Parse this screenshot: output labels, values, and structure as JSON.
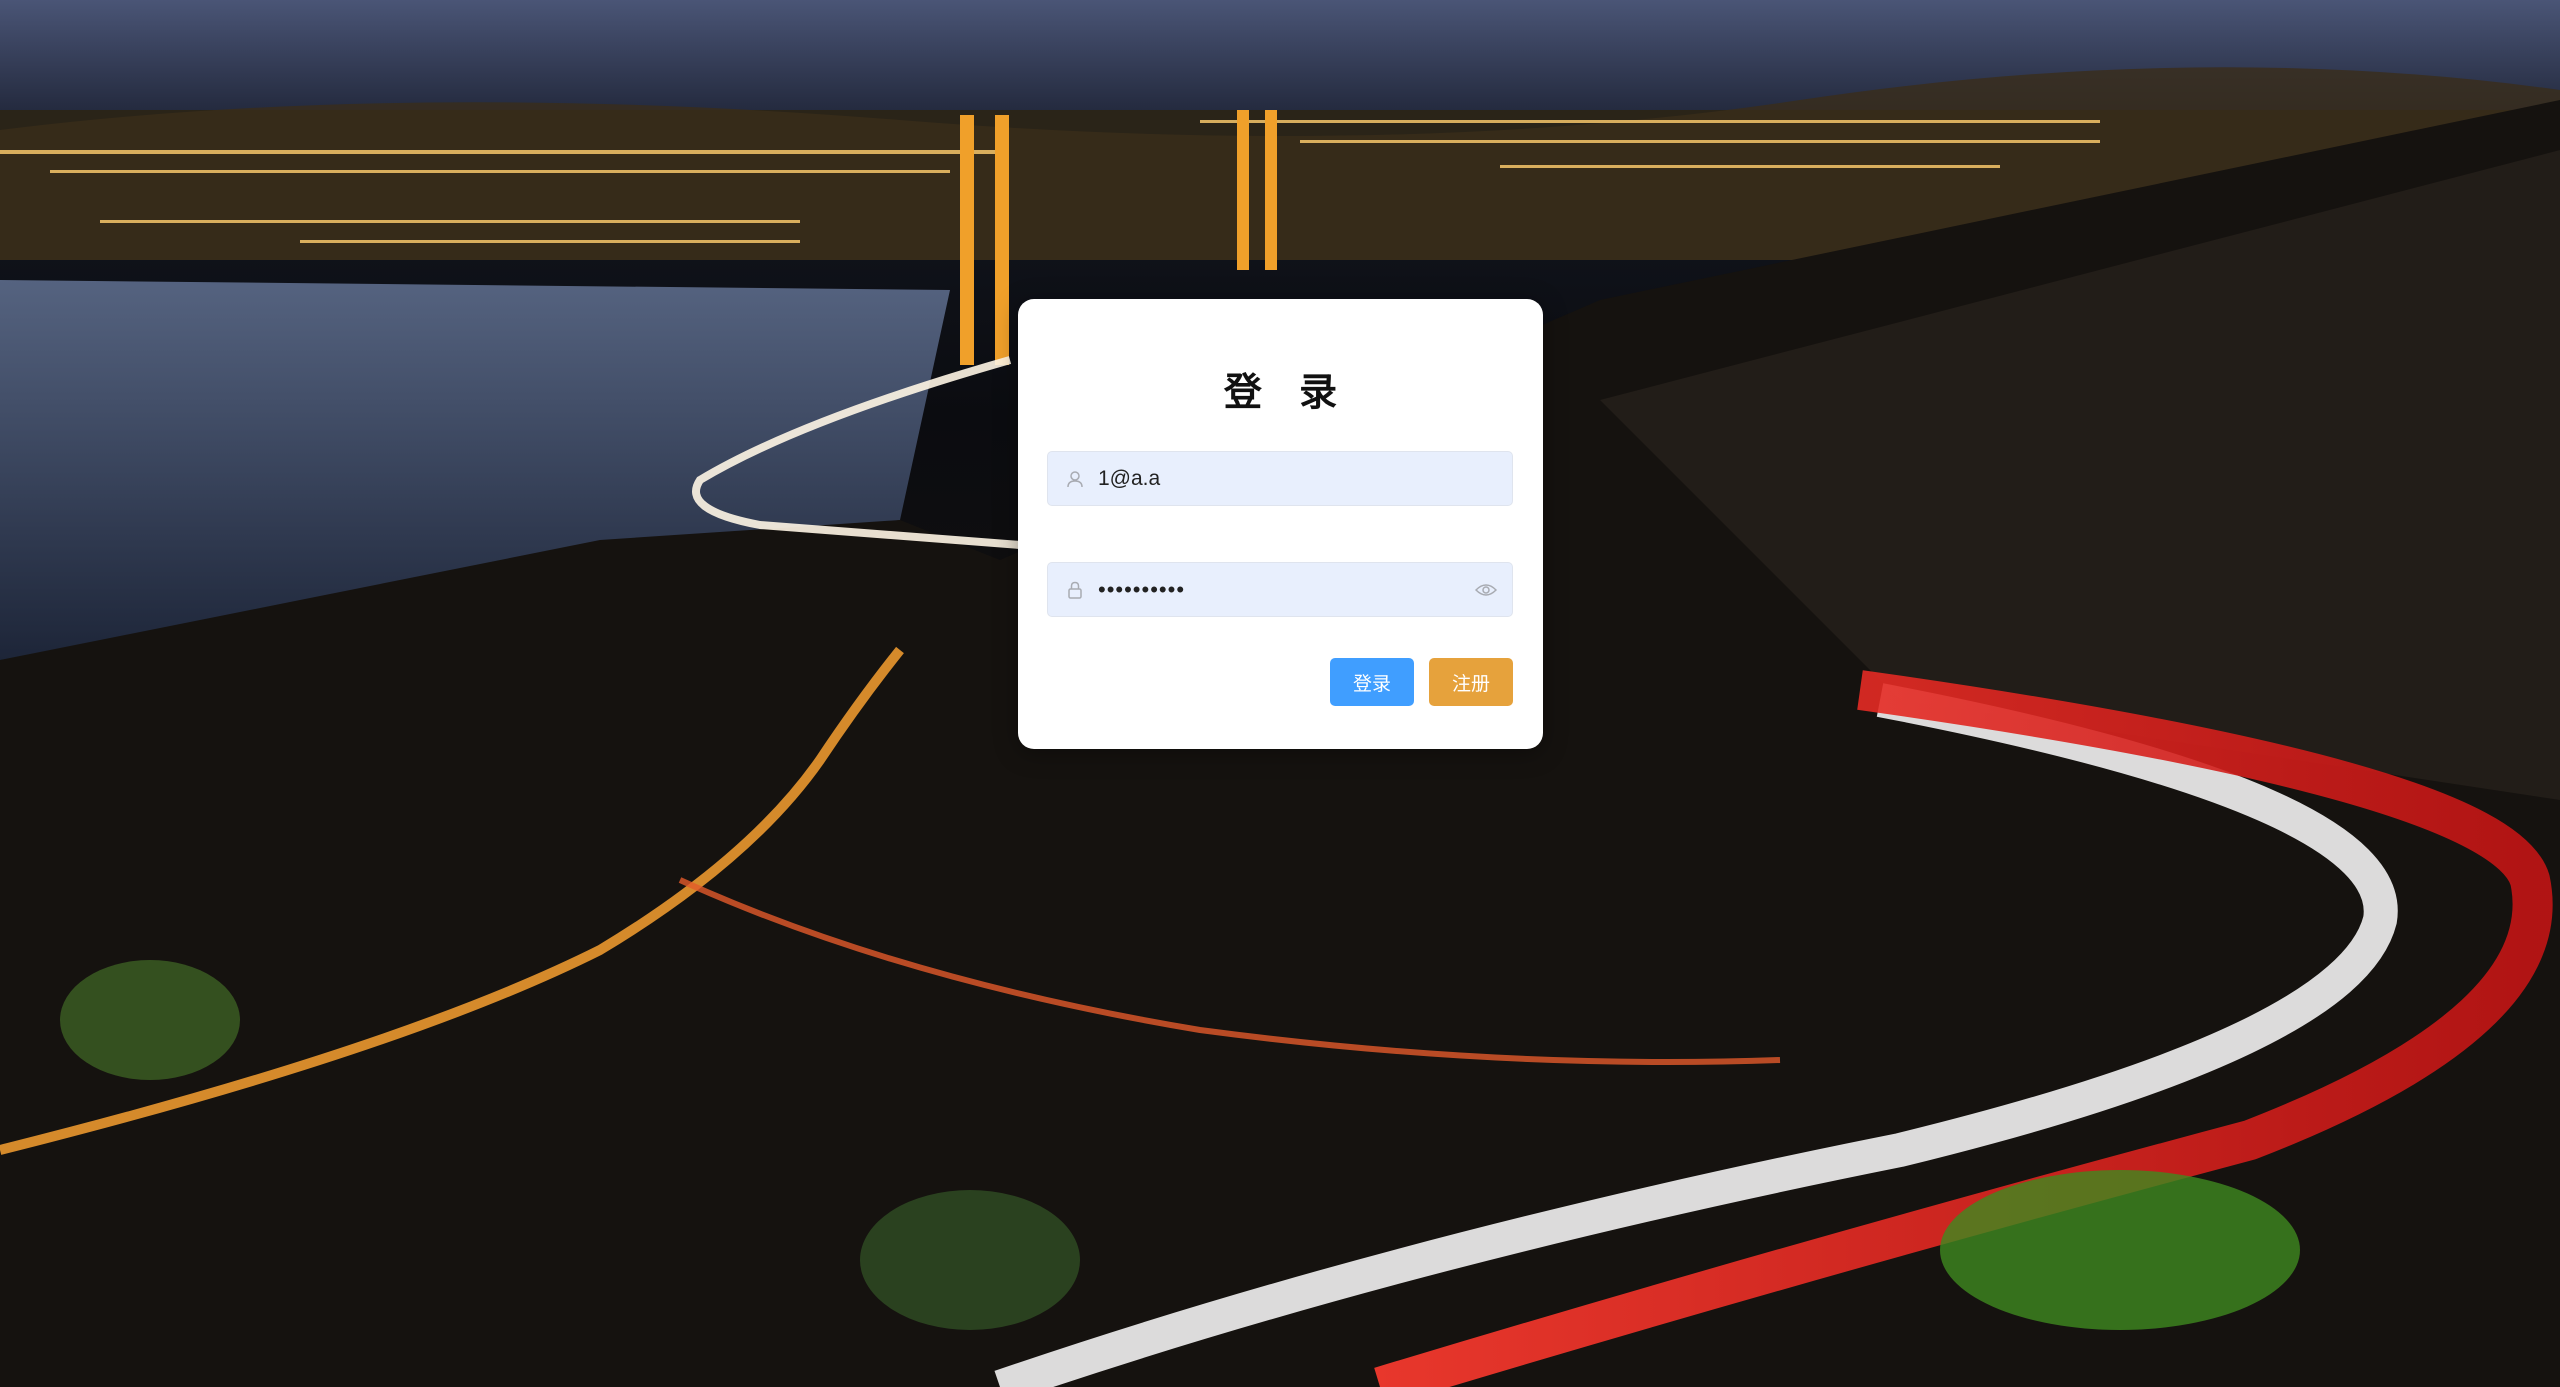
{
  "background": {
    "description_icon": "night-city-bridge-background"
  },
  "login": {
    "title": "登 录",
    "username": {
      "value": "1@a.a",
      "icon": "user-icon"
    },
    "password": {
      "value": "••••••••••",
      "icon": "lock-icon",
      "toggle_icon": "eye-icon"
    },
    "buttons": {
      "login_label": "登录",
      "register_label": "注册"
    }
  },
  "colors": {
    "primary": "#409eff",
    "warning": "#e6a23c",
    "input_bg": "#e8effd"
  }
}
